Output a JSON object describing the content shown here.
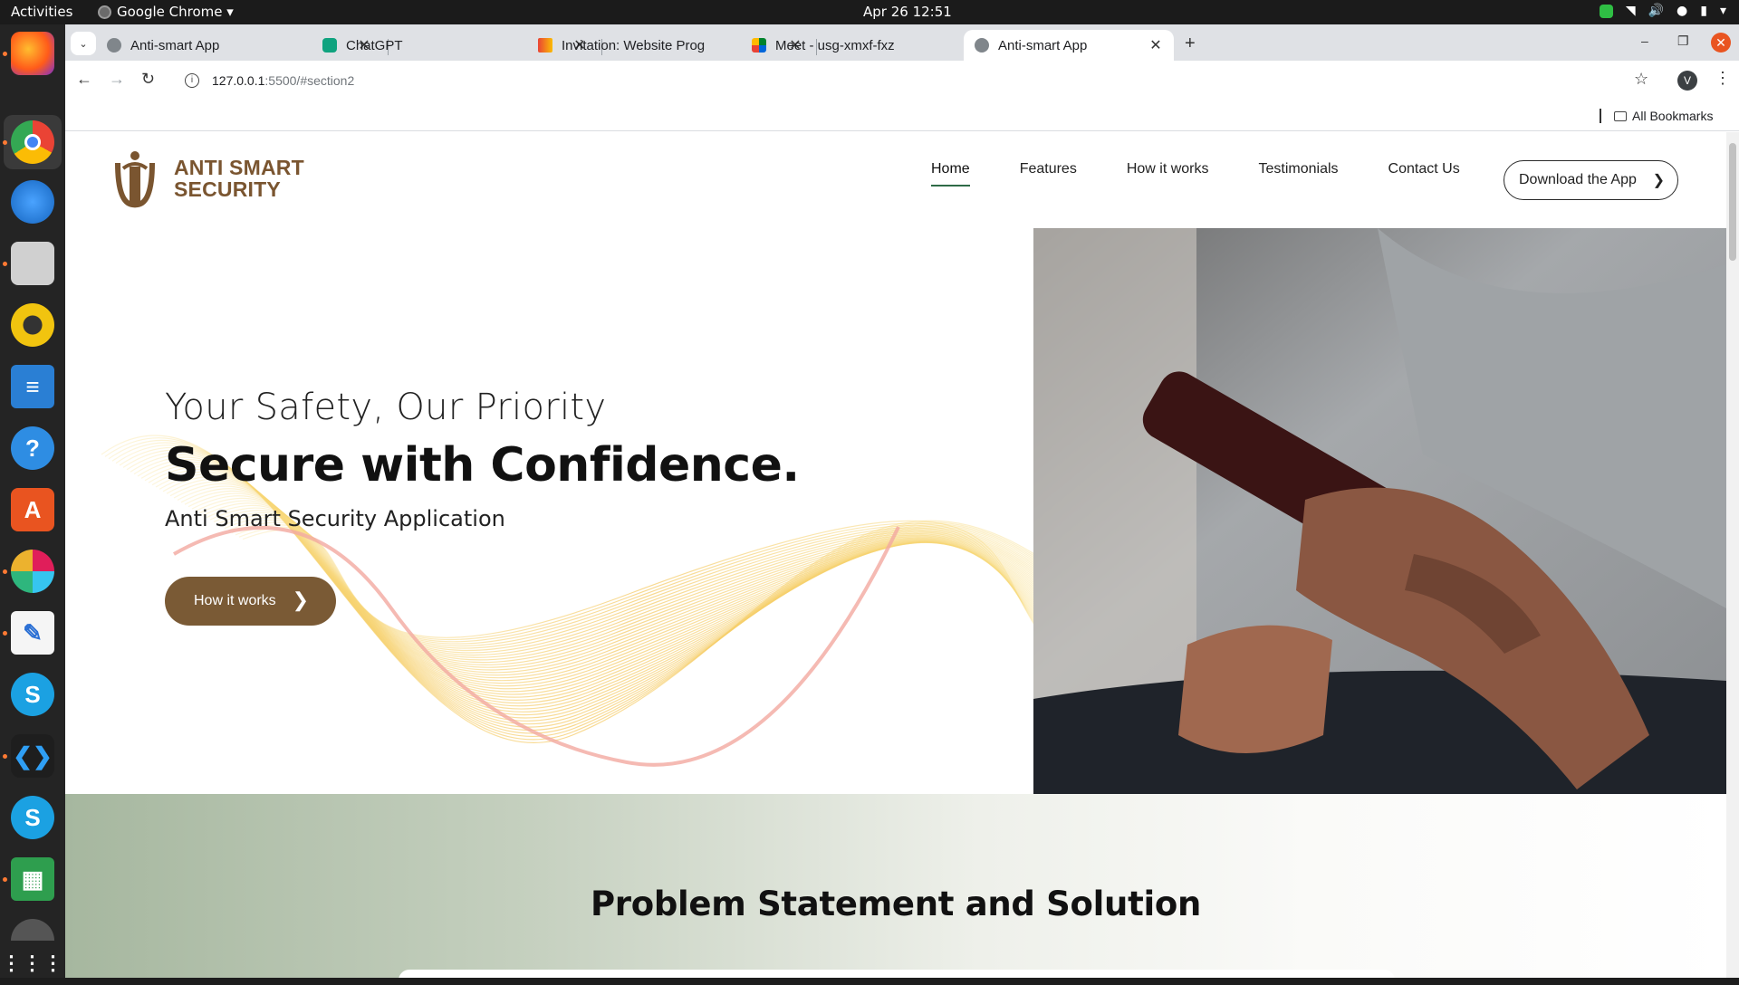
{
  "system": {
    "activities": "Activities",
    "app_name": "Google Chrome ▾",
    "clock": "Apr 26  12:51"
  },
  "dock": {
    "items": [
      "firefox-icon",
      "chrome-icon",
      "thunderbird-icon",
      "files-icon",
      "rhythmbox-icon",
      "libreoffice-writer-icon",
      "help-icon",
      "app-center-icon",
      "slack-icon",
      "text-editor-icon",
      "skype-icon",
      "vscode-icon",
      "skype-icon",
      "libreoffice-calc-icon",
      "disks-icon",
      "show-apps-icon"
    ]
  },
  "browser": {
    "tabs": [
      {
        "title": "Anti-smart App",
        "favicon_color": "#5f6368",
        "active": false
      },
      {
        "title": "ChatGPT",
        "favicon_color": "#10a37f",
        "active": false
      },
      {
        "title": "Invitation: Website Prog",
        "favicon_color": "#ea4335",
        "active": false
      },
      {
        "title": "Meet - usg-xmxf-fxz",
        "favicon_color": "#00897b",
        "active": false
      },
      {
        "title": "Anti-smart App",
        "favicon_color": "#5f6368",
        "active": true
      }
    ],
    "url_host": "127.0.0.1",
    "url_path": ":5500/#section2",
    "profile_initial": "V",
    "bookmarks_label": "All Bookmarks"
  },
  "site": {
    "logo_line1": "ANTI SMART",
    "logo_line2": "SECURITY",
    "brand_color": "#7a5530",
    "nav": [
      "Home",
      "Features",
      "How it works",
      "Testimonials",
      "Contact Us"
    ],
    "download_label": "Download the App",
    "hero": {
      "subtitle": "Your Safety, Our Priority",
      "title": "Secure with Confidence.",
      "description": "Anti Smart Security Application",
      "button_label": "How it works",
      "button_color": "#7a5a35"
    },
    "problem_title": "Problem Statement and Solution"
  }
}
